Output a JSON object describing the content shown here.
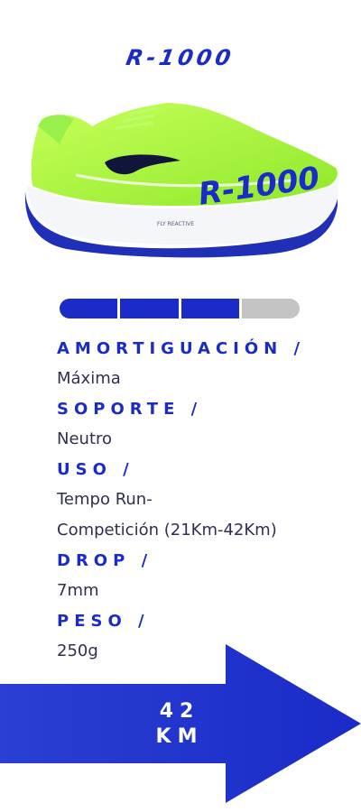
{
  "product": {
    "name": "R-1000"
  },
  "shoe_print": {
    "model": "R-1000",
    "tech": "FLY REACTIVE"
  },
  "rating": {
    "filled": 3,
    "total": 4,
    "color_filled": "#1a2bc7",
    "color_empty": "#c4c4c4"
  },
  "specs": [
    {
      "label": "AMORTIGUACIÓN /",
      "value": "Máxima"
    },
    {
      "label": "SOPORTE /",
      "value": "Neutro"
    },
    {
      "label": "USO /",
      "value": "Tempo Run-",
      "value2": "Competición (21Km-42Km)"
    },
    {
      "label": "DROP /",
      "value": "7mm"
    },
    {
      "label": "PESO /",
      "value": "250g"
    }
  ],
  "distance": {
    "value": "42",
    "unit": "KM"
  },
  "colors": {
    "brand_blue": "#1a2bc7",
    "shoe_green": "#a6f23a"
  }
}
